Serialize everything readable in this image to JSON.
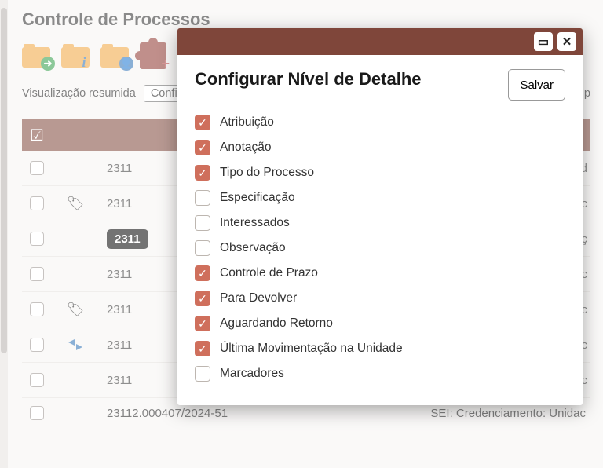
{
  "page_title": "Controle de Processos",
  "subbar": {
    "view_label": "Visualização resumida",
    "config_button": "Config",
    "right_fragment": "/er p"
  },
  "rows": [
    {
      "icon": "",
      "num": "2311",
      "right": "ão d",
      "pill": false
    },
    {
      "icon": "tag",
      "num": "2311",
      "right": "les c",
      "pill": false
    },
    {
      "icon": "",
      "num": "2311",
      "right": "licaç",
      "pill": true
    },
    {
      "icon": "",
      "num": "2311",
      "right": "idac",
      "pill": false
    },
    {
      "icon": "tag",
      "num": "2311",
      "right": "idac",
      "pill": false
    },
    {
      "icon": "arrows",
      "num": "2311",
      "right": "idac",
      "pill": false
    },
    {
      "icon": "",
      "num": "2311",
      "right": "idac",
      "pill": false
    }
  ],
  "footer": {
    "num": "23112.000407/2024-51",
    "right": "SEI: Credenciamento: Unidac"
  },
  "modal": {
    "title": "Configurar Nível de Detalhe",
    "save_prefix": "S",
    "save_rest": "alvar",
    "options": [
      {
        "label": "Atribuição",
        "checked": true
      },
      {
        "label": "Anotação",
        "checked": true
      },
      {
        "label": "Tipo do Processo",
        "checked": true
      },
      {
        "label": "Especificação",
        "checked": false
      },
      {
        "label": "Interessados",
        "checked": false
      },
      {
        "label": "Observação",
        "checked": false
      },
      {
        "label": "Controle de Prazo",
        "checked": true
      },
      {
        "label": "Para Devolver",
        "checked": true
      },
      {
        "label": "Aguardando Retorno",
        "checked": true
      },
      {
        "label": "Última Movimentação na Unidade",
        "checked": true
      },
      {
        "label": "Marcadores",
        "checked": false
      }
    ]
  }
}
